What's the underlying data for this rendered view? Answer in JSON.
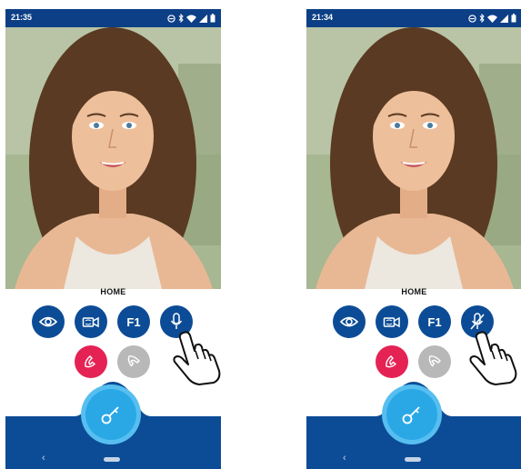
{
  "phones": [
    {
      "status_time": "21:35",
      "location_label": "HOME",
      "mic_muted": false
    },
    {
      "status_time": "21:34",
      "location_label": "HOME",
      "mic_muted": true
    }
  ],
  "icons": {
    "view": "eye-icon",
    "camera": "camera-switch-icon",
    "function": "F1",
    "mic": "microphone-icon",
    "mic_muted": "microphone-muted-icon",
    "hangup": "phone-hangup-icon",
    "answer": "phone-answer-icon",
    "door": "key-icon",
    "cursor": "hand-pointer-icon"
  },
  "colors": {
    "brand_blue": "#0c4c96",
    "status_bar": "#0c3f86",
    "hangup_red": "#e52254",
    "answer_grey": "#b8b8b8",
    "door_blue": "#2aa8e6"
  }
}
